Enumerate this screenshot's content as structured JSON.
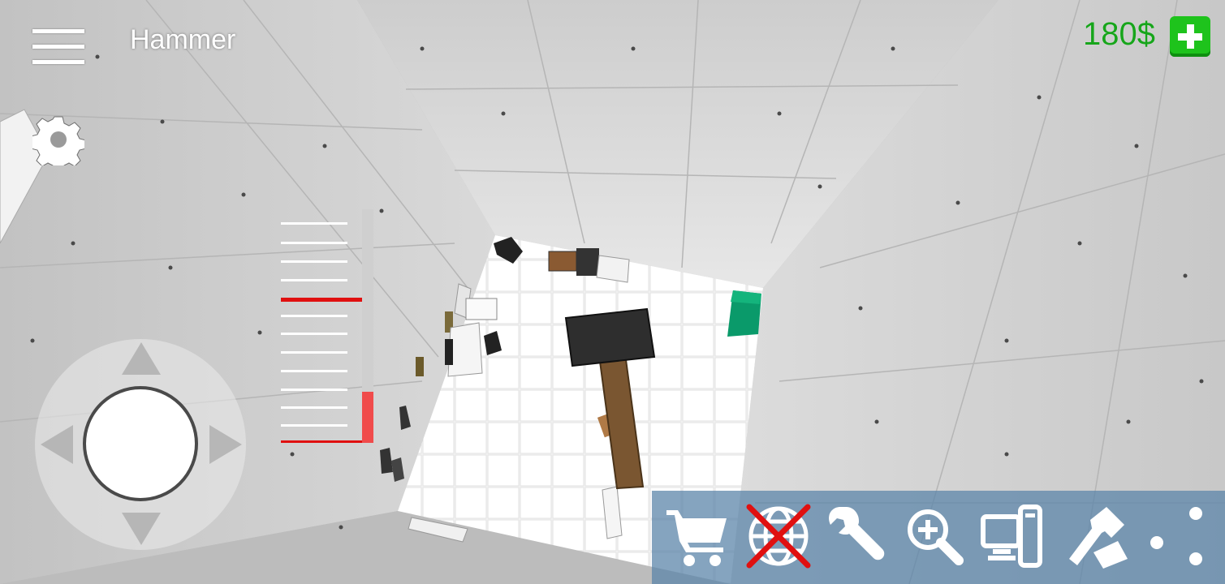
{
  "hud": {
    "tool_name": "Hammer",
    "money": "180$",
    "icons": {
      "menu": "hamburger-menu-icon",
      "settings": "gear-icon",
      "add_money": "plus-icon"
    }
  },
  "power_gauge": {
    "level": 0.22,
    "marker_level": 0.62,
    "colors": {
      "fill": "#f04b4b",
      "marker": "#e01010",
      "track": "#cfcfcf"
    }
  },
  "joystick": {
    "arrows": [
      "up",
      "down",
      "left",
      "right"
    ]
  },
  "toolbar": {
    "buttons": [
      {
        "id": "shop",
        "icon": "shopping-cart-icon"
      },
      {
        "id": "online",
        "icon": "globe-disabled-icon"
      },
      {
        "id": "tools",
        "icon": "wrench-icon"
      },
      {
        "id": "zoom",
        "icon": "zoom-in-icon"
      },
      {
        "id": "computer",
        "icon": "computer-icon"
      },
      {
        "id": "build",
        "icon": "hammer-build-icon"
      },
      {
        "id": "more",
        "icon": "more-dots-icon"
      }
    ]
  },
  "colors": {
    "money": "#17a51b",
    "toolbar": "#5c85aa",
    "cabinet": "#0a9a6a"
  }
}
